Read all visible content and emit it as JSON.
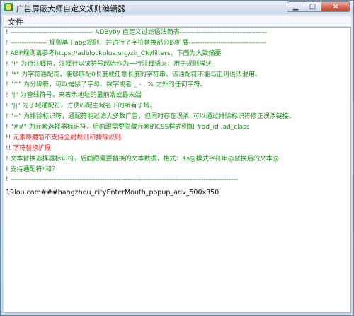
{
  "window": {
    "title": "广告屏蔽大师自定义规则编辑器",
    "colors": {
      "comment": "#1b8f1b",
      "warning": "#e0201e",
      "rule": "#111111"
    },
    "icons": {
      "app": "app-logo-icon",
      "minimize": "minimize-icon",
      "maximize": "maximize-icon",
      "close": "close-icon"
    }
  },
  "menu": {
    "file": "文件"
  },
  "editor": {
    "lines": [
      "! ------------------------------------ ADByby 自定义过滤语法简表--------------------------------------",
      "! ---------------- 规则基于abp规则，并进行了字符替换部分的扩展----------------------------------",
      "! ABP规则请参考https://adblockplus.org/zh_CN/filters，下面为大致摘要",
      "! \"!\" 为行注释符，注释行以该符号起始作为一行注释语义，用于规则描述",
      "! \"*\" 为字符通配符，能够匹配0长度或任意长度的字符串，该通配符不能与正则语法混用。",
      "! \"^\" 为分隔符，可以是除了字母、数字或者 _ - . % 之外的任何字符。",
      "! \"|\" 为管线符号，来表示地址的最前端或最末端",
      "! \"||\" 为子域通配符，方便匹配主域名下的所有子域。",
      "! \"~\" 为排除标识符，通配符能过滤大多数广告，但同时存在误杀, 可以通过排除标识符修正误杀链接。",
      "! \"##\" 为元素选择器标识符，后面跟需要隐藏元素的CSS样式例如 #ad_id .ad_class",
      "!! 元素隐藏暂不支持全局规则和排除规则",
      "!! 字符替换扩展",
      "! 文本替换选择器标识符，后面跟需要替换的文本数据，格式：$s@模式字符串@替换后的文本@",
      "! 支持通配符*和？",
      "! ---------------------------------------------------------------------------------------------------"
    ],
    "line_colors": [
      "green",
      "green",
      "green",
      "green",
      "green",
      "green",
      "green",
      "green",
      "green",
      "green",
      "red",
      "red",
      "green",
      "green",
      "green"
    ],
    "rule": "19lou.com###hangzhou_cityEnterMouth_popup_adv_500x350"
  }
}
